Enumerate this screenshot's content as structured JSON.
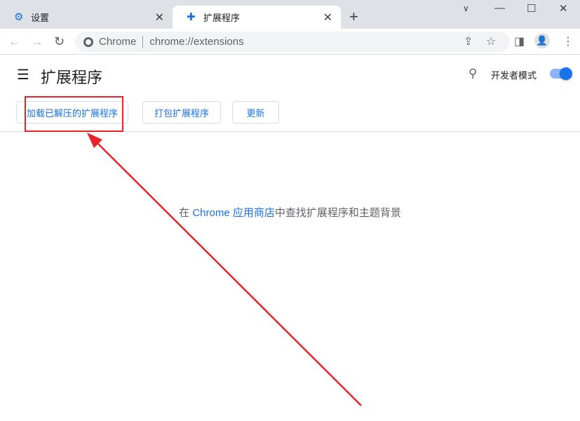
{
  "tabs": [
    {
      "title": "设置",
      "icon": "gear-icon"
    },
    {
      "title": "扩展程序",
      "icon": "puzzle-icon",
      "active": true
    }
  ],
  "omnibox": {
    "site_label": "Chrome",
    "url": "chrome://extensions"
  },
  "page": {
    "title": "扩展程序",
    "dev_mode_label": "开发者模式",
    "dev_mode_on": true
  },
  "buttons": {
    "load_unpacked": "加载已解压的扩展程序",
    "pack": "打包扩展程序",
    "update": "更新"
  },
  "empty": {
    "prefix": "在 ",
    "link": "Chrome 应用商店",
    "suffix": "中查找扩展程序和主题背景"
  },
  "colors": {
    "accent": "#1a73e8",
    "annotation": "#e8232a"
  }
}
